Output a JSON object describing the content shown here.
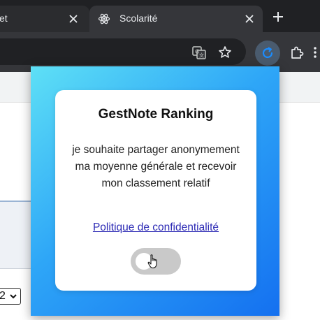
{
  "browser": {
    "tabs": [
      {
        "label": "et",
        "close_glyph": "✕"
      },
      {
        "label": "Scolarité",
        "close_glyph": "✕",
        "active": true
      }
    ],
    "new_tab_glyph": "+",
    "toolbar_icons": [
      "translate-icon",
      "star-icon",
      "extension-refresh-icon",
      "puzzle-icon",
      "menu-icon"
    ]
  },
  "page": {
    "select_value": "2"
  },
  "popup": {
    "title": "GestNote Ranking",
    "description": "je souhaite partager anonymement ma moyenne générale et recevoir mon classement relatif",
    "privacy_link": "Politique de confidentialité",
    "share_enabled": false
  },
  "colors": {
    "gradient_start": "#5ee0f6",
    "gradient_end": "#1470f0",
    "link": "#2d2bb5",
    "toggle_off": "#c9c9c9"
  }
}
